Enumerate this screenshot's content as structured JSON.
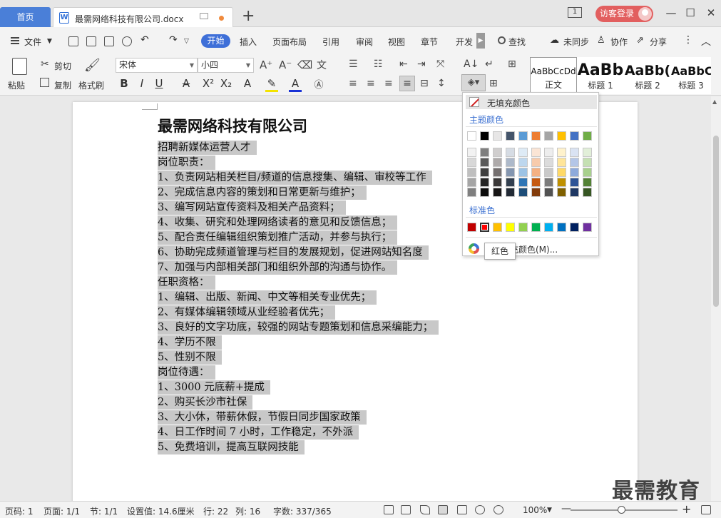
{
  "titlebar": {
    "home_tab": "首页",
    "doc_tab": "最需网络科技有限公司.docx",
    "doc_icon": "W",
    "new_tab": "+",
    "window_count": "1",
    "guest_login": "访客登录",
    "minimize": "—",
    "maximize": "☐",
    "close": "✕"
  },
  "menu": {
    "file": "文件",
    "active_tab": "开始",
    "tabs": [
      "插入",
      "页面布局",
      "引用",
      "审阅",
      "视图",
      "章节",
      "开发"
    ],
    "search": "查找",
    "unsynced": "未同步",
    "collab": "协作",
    "share": "分享",
    "more": "⋮",
    "collapse": "︿"
  },
  "ribbon": {
    "paste": "粘贴",
    "cut": "剪切",
    "copy": "复制",
    "format_painter": "格式刷",
    "font_name": "宋体",
    "font_size": "小四",
    "styles": [
      {
        "sample": "AaBbCcDd",
        "name": "正文"
      },
      {
        "sample": "AaBb",
        "name": "标题 1"
      },
      {
        "sample": "AaBb(",
        "name": "标题 2"
      },
      {
        "sample": "AaBbC",
        "name": "标题 3"
      }
    ]
  },
  "document": {
    "title": "最需网络科技有限公司",
    "lines": [
      "招聘新媒体运营人才",
      "岗位职责：",
      "1、负责网站相关栏目/频道的信息搜集、编辑、审校等工作",
      "2、完成信息内容的策划和日常更新与维护；",
      "3、编写网站宣传资料及相关产品资料；",
      "4、收集、研究和处理网络读者的意见和反馈信息；",
      "5、配合责任编辑组织策划推广活动，并参与执行；",
      "6、协助完成频道管理与栏目的发展规划，促进网站知名度",
      "7、加强与内部相关部门和组织外部的沟通与协作。",
      "任职资格：",
      "1、编辑、出版、新闻、中文等相关专业优先；",
      "2、有媒体编辑领域从业经验者优先；",
      "3、良好的文字功底，较强的网站专题策划和信息采编能力；",
      "4、学历不限",
      "5、性别不限",
      "岗位待遇：",
      "1、3000 元底薪+提成",
      "2、购买长沙市社保",
      "3、大小休，带薪休假，节假日同步国家政策",
      "4、日工作时间 7 小时，工作稳定，不外派",
      "5、免费培训，提高互联网技能"
    ],
    "highlight_color": "#c8c8c8"
  },
  "color_menu": {
    "no_fill": "无填充颜色",
    "theme_title": "主题颜色",
    "theme_row": [
      "#ffffff",
      "#000000",
      "#e7e6e6",
      "#44546a",
      "#5b9bd5",
      "#ed7d31",
      "#a5a5a5",
      "#ffc000",
      "#4472c4",
      "#70ad47"
    ],
    "theme_shades": [
      [
        "#f2f2f2",
        "#7f7f7f",
        "#d0cece",
        "#d6dce4",
        "#deebf6",
        "#fbe5d5",
        "#ededed",
        "#fff2cc",
        "#dae3f3",
        "#e2efd9"
      ],
      [
        "#d8d8d8",
        "#595959",
        "#aeaaaa",
        "#adb9ca",
        "#bdd7ee",
        "#f7cbac",
        "#dbdbdb",
        "#ffe599",
        "#b4c6e7",
        "#c5e0b3"
      ],
      [
        "#bfbfbf",
        "#3f3f3f",
        "#757070",
        "#8496b0",
        "#9cc3e5",
        "#f4b183",
        "#c9c9c9",
        "#ffd966",
        "#8eaadb",
        "#a8d08d"
      ],
      [
        "#a5a5a5",
        "#262626",
        "#3a3838",
        "#323f4f",
        "#2e75b5",
        "#c55a11",
        "#7b7b7b",
        "#bf9000",
        "#2f5496",
        "#538135"
      ],
      [
        "#7f7f7f",
        "#0c0c0c",
        "#171616",
        "#222a35",
        "#1e4e79",
        "#833c0b",
        "#525252",
        "#7f6000",
        "#1f3864",
        "#375623"
      ]
    ],
    "standard_title": "标准色",
    "standard": [
      "#c00000",
      "#ff0000",
      "#ffc000",
      "#ffff00",
      "#92d050",
      "#00b050",
      "#00b0f0",
      "#0070c0",
      "#002060",
      "#7030a0"
    ],
    "selected_index": 1,
    "more": "其他填充颜色(M)...",
    "tooltip": "红色"
  },
  "status": {
    "page_num": "页码: 1",
    "pages": "页面: 1/1",
    "section": "节: 1/1",
    "setting": "设置值: 14.6厘米",
    "row": "行: 22",
    "col": "列: 16",
    "words": "字数: 337/365",
    "zoom": "100%",
    "zoom_level": 0.47,
    "watermark": "最需教育"
  }
}
